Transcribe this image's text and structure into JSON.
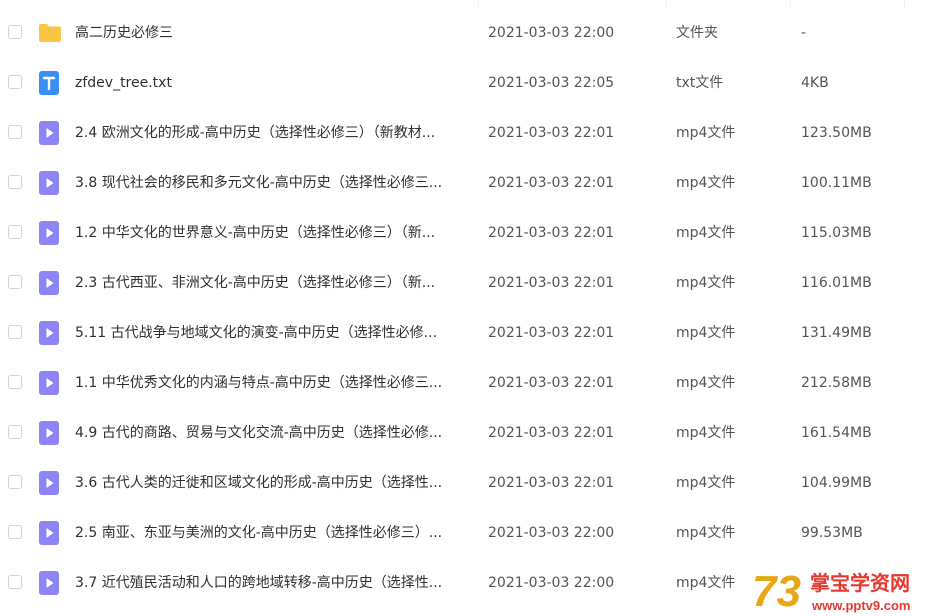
{
  "files": [
    {
      "name": "高二历史必修三",
      "date": "2021-03-03 22:00",
      "type": "文件夹",
      "size": "-",
      "icon": "folder-icon"
    },
    {
      "name": "zfdev_tree.txt",
      "date": "2021-03-03 22:05",
      "type": "txt文件",
      "size": "4KB",
      "icon": "txt-file-icon"
    },
    {
      "name": "2.4 欧洲文化的形成-高中历史（选择性必修三）（新教材...",
      "date": "2021-03-03 22:01",
      "type": "mp4文件",
      "size": "123.50MB",
      "icon": "video-file-icon"
    },
    {
      "name": "3.8 现代社会的移民和多元文化-高中历史（选择性必修三...",
      "date": "2021-03-03 22:01",
      "type": "mp4文件",
      "size": "100.11MB",
      "icon": "video-file-icon"
    },
    {
      "name": "1.2 中华文化的世界意义-高中历史（选择性必修三）（新...",
      "date": "2021-03-03 22:01",
      "type": "mp4文件",
      "size": "115.03MB",
      "icon": "video-file-icon"
    },
    {
      "name": "2.3 古代西亚、非洲文化-高中历史（选择性必修三）（新...",
      "date": "2021-03-03 22:01",
      "type": "mp4文件",
      "size": "116.01MB",
      "icon": "video-file-icon"
    },
    {
      "name": "5.11 古代战争与地域文化的演变-高中历史（选择性必修...",
      "date": "2021-03-03 22:01",
      "type": "mp4文件",
      "size": "131.49MB",
      "icon": "video-file-icon"
    },
    {
      "name": "1.1 中华优秀文化的内涵与特点-高中历史（选择性必修三...",
      "date": "2021-03-03 22:01",
      "type": "mp4文件",
      "size": "212.58MB",
      "icon": "video-file-icon"
    },
    {
      "name": "4.9 古代的商路、贸易与文化交流-高中历史（选择性必修...",
      "date": "2021-03-03 22:01",
      "type": "mp4文件",
      "size": "161.54MB",
      "icon": "video-file-icon"
    },
    {
      "name": "3.6 古代人类的迁徙和区域文化的形成-高中历史（选择性...",
      "date": "2021-03-03 22:01",
      "type": "mp4文件",
      "size": "104.99MB",
      "icon": "video-file-icon"
    },
    {
      "name": "2.5 南亚、东亚与美洲的文化-高中历史（选择性必修三）...",
      "date": "2021-03-03 22:00",
      "type": "mp4文件",
      "size": "99.53MB",
      "icon": "video-file-icon"
    },
    {
      "name": "3.7 近代殖民活动和人口的跨地域转移-高中历史（选择性...",
      "date": "2021-03-03 22:00",
      "type": "mp4文件",
      "size": "",
      "icon": "video-file-icon"
    }
  ],
  "watermark": {
    "logo_text": "73",
    "title": "掌宝学资网",
    "url": "www.pptv9.com"
  },
  "colors": {
    "folder": "#f8c544",
    "txt": "#3a8ff5",
    "video": "#8c84f7",
    "text": "#2f3033",
    "muted": "#555555",
    "watermark_red": "#e8382f",
    "watermark_gold": "#e6a817"
  }
}
